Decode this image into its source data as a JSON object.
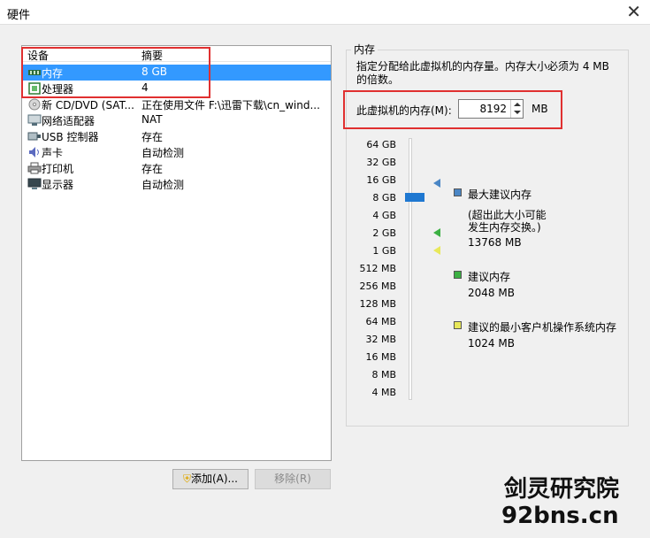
{
  "window": {
    "title": "硬件"
  },
  "devices": {
    "header": {
      "device": "设备",
      "summary": "摘要"
    },
    "rows": [
      {
        "name": "内存",
        "summary": "8 GB",
        "icon": "memory-icon"
      },
      {
        "name": "处理器",
        "summary": "4",
        "icon": "processor-icon"
      },
      {
        "name": "新 CD/DVD (SAT...",
        "summary": "正在使用文件 F:\\迅雷下载\\cn_wind...",
        "icon": "cd-dvd-icon"
      },
      {
        "name": "网络适配器",
        "summary": "NAT",
        "icon": "network-adapter-icon"
      },
      {
        "name": "USB 控制器",
        "summary": "存在",
        "icon": "usb-icon"
      },
      {
        "name": "声卡",
        "summary": "自动检测",
        "icon": "sound-card-icon"
      },
      {
        "name": "打印机",
        "summary": "存在",
        "icon": "printer-icon"
      },
      {
        "name": "显示器",
        "summary": "自动检测",
        "icon": "display-icon"
      }
    ],
    "add_button": "添加(A)...",
    "remove_button": "移除(R)"
  },
  "memory": {
    "group_title": "内存",
    "description": "指定分配给此虚拟机的内存量。内存大小必须为 4 MB 的倍数。",
    "field_label": "此虚拟机的内存(M):",
    "value": "8192",
    "unit": "MB",
    "scale_ticks": [
      "64 GB",
      "32 GB",
      "16 GB",
      "8 GB",
      "4 GB",
      "2 GB",
      "1 GB",
      "512 MB",
      "256 MB",
      "128 MB",
      "64 MB",
      "32 MB",
      "16 MB",
      "8 MB",
      "4 MB"
    ],
    "legend": {
      "max_title": "最大建议内存",
      "max_note_1": "(超出此大小可能",
      "max_note_2": "发生内存交换。)",
      "max_value": "13768 MB",
      "rec_title": "建议内存",
      "rec_value": "2048 MB",
      "min_title": "建议的最小客户机操作系统内存",
      "min_value": "1024 MB"
    },
    "colors": {
      "max": "#4a86c5",
      "rec": "#3cb043",
      "min": "#e8e85a",
      "thumb": "#1f78d1"
    }
  },
  "watermark": {
    "line1": "剑灵研究院",
    "line2": "92bns.cn"
  }
}
